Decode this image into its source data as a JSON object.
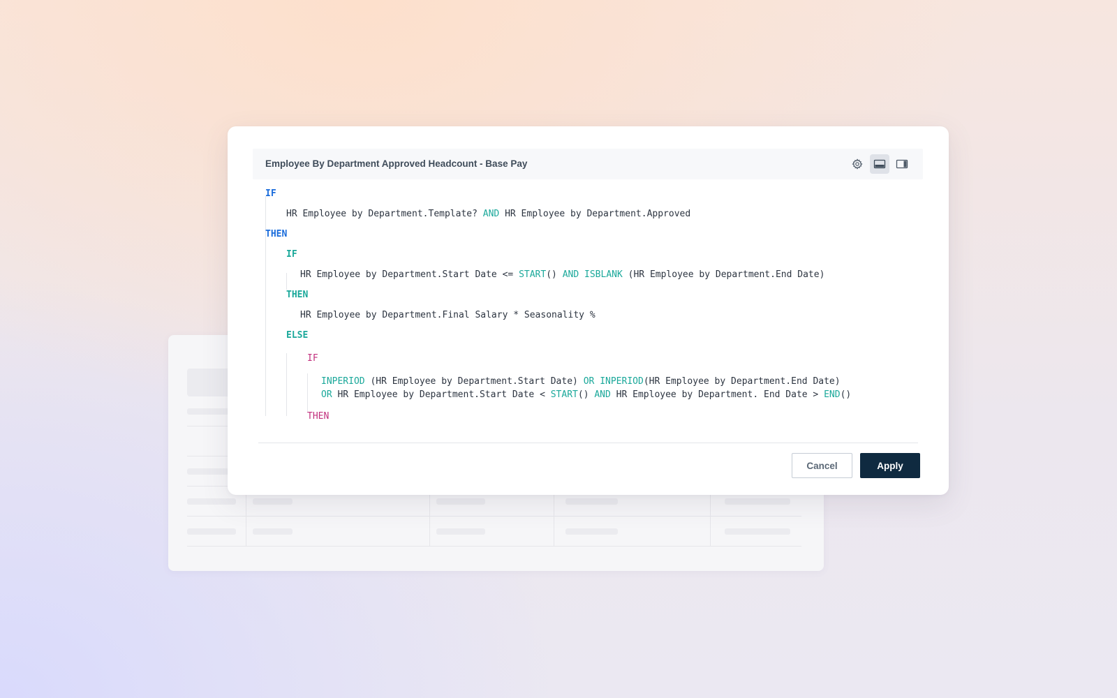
{
  "dialog": {
    "title": "Employee By Department Approved Headcount - Base Pay",
    "header_icons": [
      "gear-icon",
      "bottom-panel-icon",
      "right-panel-icon"
    ],
    "cancel_label": "Cancel",
    "apply_label": "Apply"
  },
  "formula": {
    "kw_if": "IF",
    "kw_then": "THEN",
    "kw_else": "ELSE",
    "kw_and": "AND",
    "kw_or": "OR",
    "fn_start": "START",
    "fn_end": "END",
    "fn_isblank": "ISBLANK",
    "fn_inperiod": "INPERIOD",
    "line2_a": "HR Employee by Department.Template? ",
    "line2_b": " HR Employee by Department.Approved",
    "line5_a": "HR Employee by Department.Start Date <= ",
    "line5_b": "() ",
    "line5_c": " (HR Employee by Department.End Date)",
    "line7": "HR Employee by Department.Final Salary * Seasonality %",
    "line10_a": " (HR Employee by Department.Start Date) ",
    "line10_b": "(HR Employee by Department.End Date)",
    "line11_a": " HR Employee by Department.Start Date < ",
    "line11_b": "() ",
    "line11_c": " HR Employee by Department. End Date > ",
    "line11_d": "()"
  },
  "colors": {
    "keyword_blue": "#1a6cdb",
    "keyword_teal": "#1aa89a",
    "keyword_pink": "#c2307d",
    "apply_button": "#0f2a40"
  }
}
